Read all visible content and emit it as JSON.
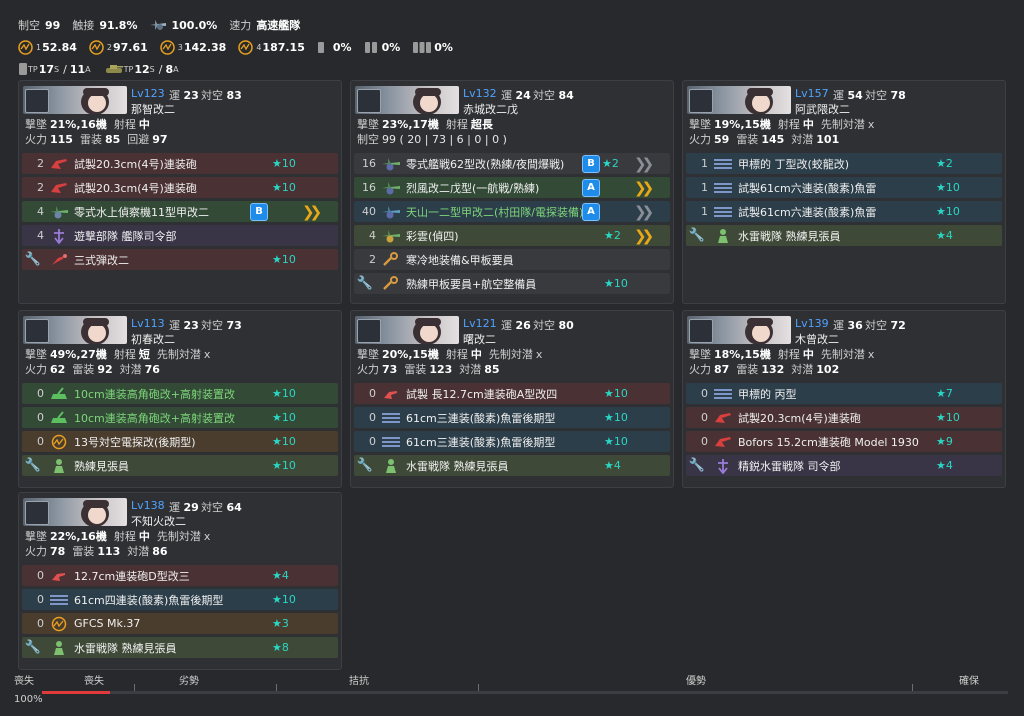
{
  "header": {
    "air_control_label": "制空",
    "air_control_value": "99",
    "los_label": "触接",
    "los_value": "91.8%",
    "contact_value": "100.0%",
    "speed_label": "速力",
    "speed_value": "高速艦隊",
    "los1": "1",
    "los1_value": "52.84",
    "los2": "2",
    "los2_value": "97.61",
    "los3": "3",
    "los3_value": "142.38",
    "los4": "4",
    "los4_value": "187.15",
    "drum1_value": "0%",
    "drum2_value": "0%",
    "drum3_value": "0%",
    "tp_label": "TP",
    "tp_s": "17",
    "s_label": "S",
    "tp_sep": "/",
    "tp_a": "11",
    "a_label": "A",
    "tank_tp_label": "TP",
    "tank_s": "12",
    "tank_s_label": "S",
    "tank_sep": "/",
    "tank_a": "8",
    "tank_a_label": "A"
  },
  "labels": {
    "luck": "運",
    "asw": "対空",
    "intercept": "撃墜",
    "range": "射程",
    "firepower": "火力",
    "torpedo": "雷装",
    "evasion": "回避",
    "aa_sub": "対潜",
    "oasw": "先制対潜",
    "x": "x",
    "air_control": "制空"
  },
  "ships": [
    {
      "level": "Lv123",
      "luck": "23",
      "aa": "83",
      "name": "那智改二",
      "intercept": "21%,16機",
      "range": "中",
      "firepower": "115",
      "torpedo": "85",
      "third_label": "回避",
      "third": "97",
      "equips": [
        {
          "slot": "2",
          "name": "試製20.3cm(4号)連装砲",
          "star": "★10",
          "bg": "red",
          "icon": "main-gun-icon"
        },
        {
          "slot": "2",
          "name": "試製20.3cm(4号)連装砲",
          "star": "★10",
          "bg": "red",
          "icon": "main-gun-icon"
        },
        {
          "slot": "4",
          "name": "零式水上偵察機11型甲改二",
          "badge": "B",
          "chev": "gold",
          "bg": "green",
          "icon": "seaplane-icon"
        },
        {
          "slot": "4",
          "name": "遊撃部隊 艦隊司令部",
          "bg": "purple",
          "icon": "command-icon"
        },
        {
          "slot": "",
          "name": "三式弾改二",
          "star": "★10",
          "bg": "red",
          "icon": "ammo-icon",
          "ex": true
        }
      ]
    },
    {
      "level": "Lv132",
      "luck": "24",
      "aa": "84",
      "name": "赤城改二戊",
      "intercept": "23%,17機",
      "range": "超長",
      "air_row": "99 ( 20 | 73 | 6 | 0 | 0 )",
      "equips": [
        {
          "slot": "16",
          "name": "零式艦戦62型改(熟練/夜間爆戦)",
          "badge": "B",
          "star": "★2",
          "chev": "gray",
          "bg": "gray",
          "icon": "night-fighter-icon"
        },
        {
          "slot": "16",
          "name": "烈風改二戊型(一航戦/熟練)",
          "badge": "A",
          "chev": "gold",
          "bg": "green",
          "icon": "night-fighter-icon"
        },
        {
          "slot": "40",
          "name": "天山一二型甲改二(村田隊/電探装備)",
          "badge": "A",
          "chev": "gray",
          "bg": "teal",
          "icon": "night-bomber-icon",
          "green": true
        },
        {
          "slot": "4",
          "name": "彩雲(偵四)",
          "star": "★2",
          "chev": "gold",
          "bg": "olive",
          "icon": "recon-icon"
        },
        {
          "slot": "2",
          "name": "寒冷地装備&甲板要員",
          "bg": "gray",
          "icon": "wrench-icon"
        },
        {
          "slot": "",
          "name": "熟練甲板要員+航空整備員",
          "star": "★10",
          "bg": "gray",
          "icon": "wrench-icon",
          "ex": true
        }
      ]
    },
    {
      "level": "Lv157",
      "luck": "54",
      "aa": "78",
      "name": "阿武隈改二",
      "intercept": "19%,15機",
      "range": "中",
      "oasw": true,
      "firepower": "59",
      "torpedo": "145",
      "third_label": "対潜",
      "third": "101",
      "equips": [
        {
          "slot": "1",
          "name": "甲標的 丁型改(蛟龍改)",
          "star": "★2",
          "bg": "teal",
          "icon": "torpedo-icon"
        },
        {
          "slot": "1",
          "name": "試製61cm六連装(酸素)魚雷",
          "star": "★10",
          "bg": "teal",
          "icon": "torpedo-icon"
        },
        {
          "slot": "1",
          "name": "試製61cm六連装(酸素)魚雷",
          "star": "★10",
          "bg": "teal",
          "icon": "torpedo-icon"
        },
        {
          "slot": "",
          "name": "水雷戦隊 熟練見張員",
          "star": "★4",
          "bg": "olive",
          "icon": "lookout-icon",
          "ex": true
        }
      ]
    },
    {
      "level": "Lv113",
      "luck": "23",
      "aa": "73",
      "name": "初春改二",
      "intercept": "49%,27機",
      "range": "短",
      "oasw": true,
      "firepower": "62",
      "torpedo": "92",
      "third_label": "対潜",
      "third": "76",
      "equips": [
        {
          "slot": "0",
          "name": "10cm連装高角砲改+高射装置改",
          "star": "★10",
          "bg": "green",
          "icon": "ha-gun-icon",
          "green": true
        },
        {
          "slot": "0",
          "name": "10cm連装高角砲改+高射装置改",
          "star": "★10",
          "bg": "green",
          "icon": "ha-gun-icon",
          "green": true
        },
        {
          "slot": "0",
          "name": "13号対空電探改(後期型)",
          "star": "★10",
          "bg": "brown",
          "icon": "radar-icon"
        },
        {
          "slot": "",
          "name": "熟練見張員",
          "star": "★10",
          "bg": "olive",
          "icon": "lookout-icon",
          "ex": true
        }
      ]
    },
    {
      "level": "Lv121",
      "luck": "26",
      "aa": "80",
      "name": "曙改二",
      "intercept": "20%,15機",
      "range": "中",
      "oasw": true,
      "firepower": "73",
      "torpedo": "123",
      "third_label": "対潜",
      "third": "85",
      "equips": [
        {
          "slot": "0",
          "name": "試製 長12.7cm連装砲A型改四",
          "star": "★10",
          "bg": "red",
          "icon": "small-gun-icon"
        },
        {
          "slot": "0",
          "name": "61cm三連装(酸素)魚雷後期型",
          "star": "★10",
          "bg": "teal",
          "icon": "torpedo-icon"
        },
        {
          "slot": "0",
          "name": "61cm三連装(酸素)魚雷後期型",
          "star": "★10",
          "bg": "teal",
          "icon": "torpedo-icon"
        },
        {
          "slot": "",
          "name": "水雷戦隊 熟練見張員",
          "star": "★4",
          "bg": "olive",
          "icon": "lookout-icon",
          "ex": true
        }
      ]
    },
    {
      "level": "Lv139",
      "luck": "36",
      "aa": "72",
      "name": "木曾改二",
      "intercept": "18%,15機",
      "range": "中",
      "oasw": true,
      "firepower": "87",
      "torpedo": "132",
      "third_label": "対潜",
      "third": "102",
      "equips": [
        {
          "slot": "0",
          "name": "甲標的 丙型",
          "star": "★7",
          "bg": "teal",
          "icon": "torpedo-icon"
        },
        {
          "slot": "0",
          "name": "試製20.3cm(4号)連装砲",
          "star": "★10",
          "bg": "red",
          "icon": "main-gun-icon"
        },
        {
          "slot": "0",
          "name": "Bofors 15.2cm連装砲 Model 1930",
          "star": "★9",
          "bg": "red",
          "icon": "main-gun-icon"
        },
        {
          "slot": "",
          "name": "精鋭水雷戦隊 司令部",
          "star": "★4",
          "bg": "purple",
          "icon": "command-icon",
          "ex": true
        }
      ]
    },
    {
      "level": "Lv138",
      "luck": "29",
      "aa": "64",
      "name": "不知火改二",
      "intercept": "22%,16機",
      "range": "中",
      "oasw": true,
      "firepower": "78",
      "torpedo": "113",
      "third_label": "対潜",
      "third": "86",
      "equips": [
        {
          "slot": "0",
          "name": "12.7cm連装砲D型改三",
          "star": "★4",
          "bg": "red",
          "icon": "small-gun-icon"
        },
        {
          "slot": "0",
          "name": "61cm四連装(酸素)魚雷後期型",
          "star": "★10",
          "bg": "teal",
          "icon": "torpedo-icon"
        },
        {
          "slot": "0",
          "name": "GFCS Mk.37",
          "star": "★3",
          "bg": "brown",
          "icon": "radar-icon"
        },
        {
          "slot": "",
          "name": "水雷戦隊 熟練見張員",
          "star": "★8",
          "bg": "olive",
          "icon": "lookout-icon",
          "ex": true
        }
      ]
    }
  ],
  "footer": {
    "status": "喪失",
    "labels": [
      "喪失",
      "劣勢",
      "拮抗",
      "優勢",
      "確保"
    ],
    "percent": "100%",
    "fill_fraction": 0.07
  },
  "colors": {
    "accent": "#4ea3ff",
    "star": "#2ad6c4",
    "badge": "#1e8ce8",
    "loss": "#e03a3a"
  }
}
